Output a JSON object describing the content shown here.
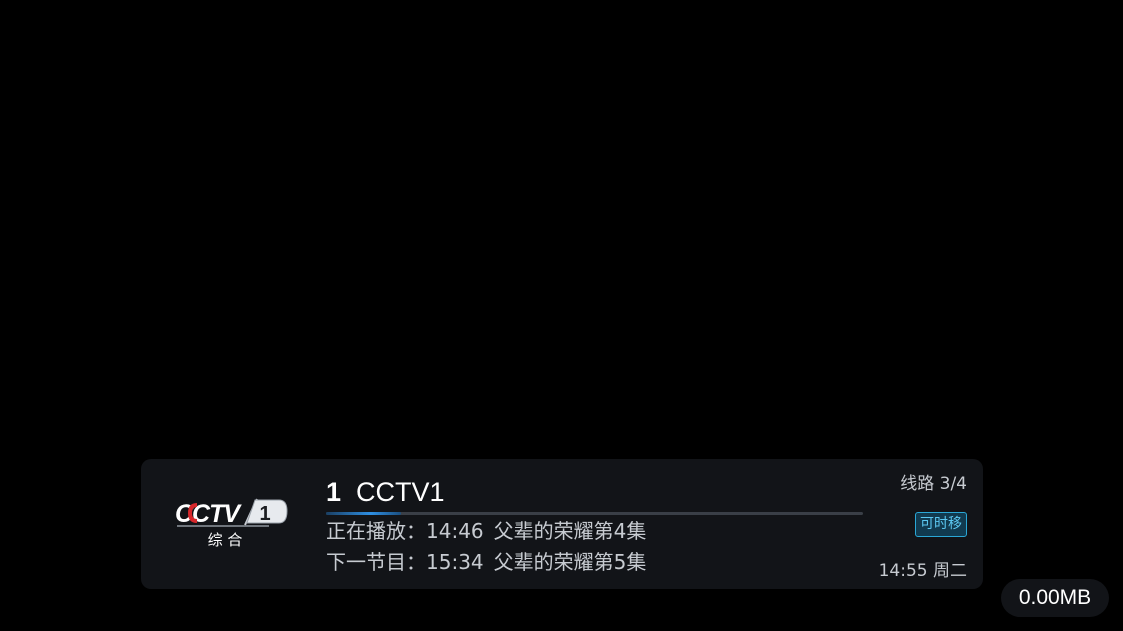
{
  "channel": {
    "number": "1",
    "name": "CCTV1",
    "logo": {
      "icon": "cctv1-logo",
      "text": "CCTV",
      "number": "1",
      "subtitle": "综 合"
    },
    "progress_fraction": 0.14
  },
  "program": {
    "now_label": "正在播放：",
    "now_time": "14:46",
    "now_title": "父辈的荣耀第4集",
    "next_label": "下一节目：",
    "next_time": "15:34",
    "next_title": "父辈的荣耀第5集"
  },
  "line": {
    "text": "线路 3/4"
  },
  "timeshift": {
    "label": "可时移"
  },
  "clock": {
    "text": "14:55 周二"
  },
  "network": {
    "speed": "0.00MB"
  },
  "colors": {
    "background": "#000000",
    "panel": "#121418",
    "accent_blue": "#2e8fe3",
    "badge_cyan": "#5cc8f2",
    "logo_red": "#d7272b"
  }
}
